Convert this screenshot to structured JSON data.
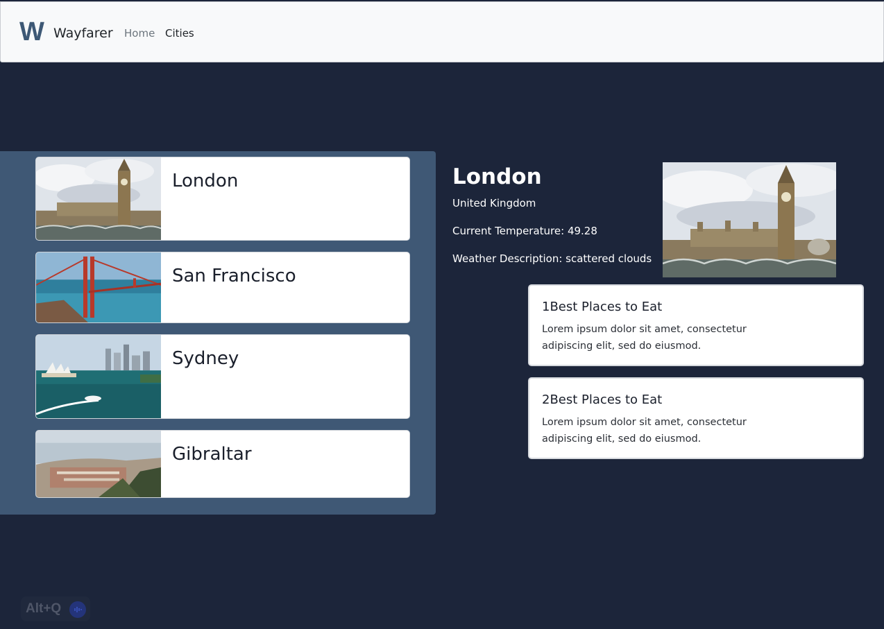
{
  "navbar": {
    "logo_letter": "W",
    "brand": "Wayfarer",
    "links": [
      {
        "label": "Home"
      },
      {
        "label": "Cities"
      }
    ]
  },
  "cities": [
    {
      "name": "London",
      "image": "big-ben-image"
    },
    {
      "name": "San Francisco",
      "image": "golden-gate-image"
    },
    {
      "name": "Sydney",
      "image": "sydney-harbour-image"
    },
    {
      "name": "Gibraltar",
      "image": "gibraltar-image"
    }
  ],
  "detail": {
    "city": "London",
    "country": "United Kingdom",
    "temperature": "Current Temperature: 49.28",
    "weather": "Weather Description: scattered clouds",
    "image": "big-ben-image"
  },
  "posts": [
    {
      "title": "1Best Places to Eat",
      "body": "Lorem ipsum dolor sit amet, consectetur adipiscing elit, sed do eiusmod."
    },
    {
      "title": "2Best Places to Eat",
      "body": "Lorem ipsum dolor sit amet, consectetur adipiscing elit, sed do eiusmod."
    }
  ],
  "overlay": {
    "label": "Alt+Q",
    "icon": "voice-wave-icon"
  },
  "colors": {
    "page_bg": "#1c253a",
    "panel_bg": "#3f5875",
    "navbar_bg": "#f8f9fa",
    "logo": "#3d5875"
  }
}
